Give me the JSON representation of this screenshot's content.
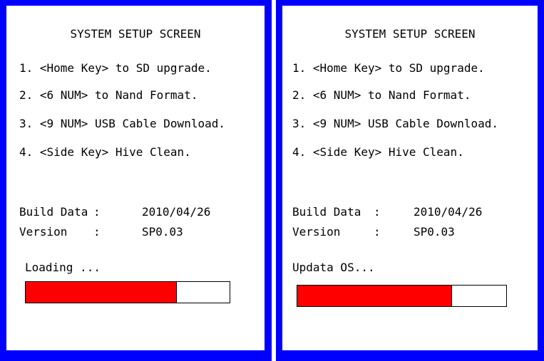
{
  "frame_color": "#0000ff",
  "progress_color": "#ff0000",
  "screens": [
    {
      "title": "SYSTEM SETUP SCREEN",
      "menu": [
        "1. <Home Key> to SD upgrade.",
        "2. <6 NUM> to Nand Format.",
        "3. <9 NUM> USB Cable Download.",
        "4. <Side Key> Hive Clean."
      ],
      "build_label": "Build Data",
      "build_sep": ":",
      "build_value": "2010/04/26",
      "version_label": "Version",
      "version_sep": ":",
      "version_value": "SP0.03",
      "status": "Loading ...",
      "progress": 0.74
    },
    {
      "title": "SYSTEM SETUP SCREEN",
      "menu": [
        "1. <Home Key> to SD upgrade.",
        "2. <6 NUM> to Nand Format.",
        "3. <9 NUM> USB Cable Download.",
        "4. <Side Key> Hive Clean."
      ],
      "build_label": "Build Data",
      "build_sep": ":",
      "build_value": "2010/04/26",
      "version_label": "Version",
      "version_sep": ":",
      "version_value": "SP0.03",
      "status": "Updata OS...",
      "progress": 0.74
    }
  ]
}
